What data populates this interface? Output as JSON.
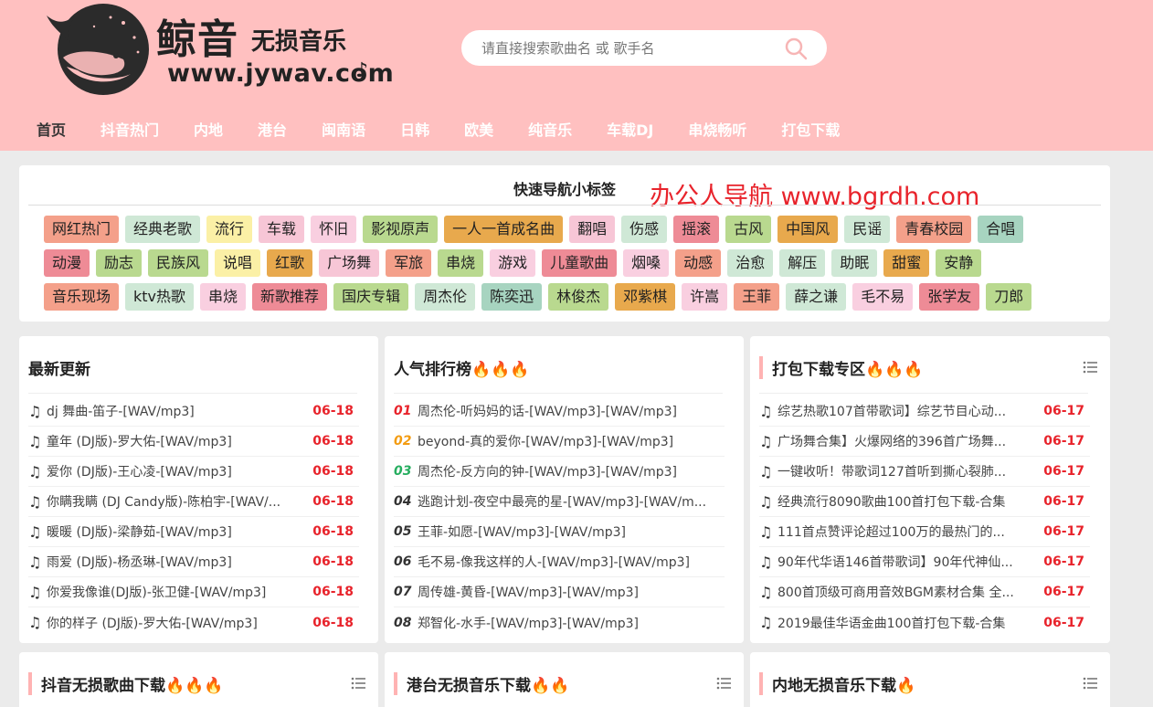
{
  "logo": {
    "title": "鲸音",
    "subtitle": "无损音乐",
    "url": "www.jywav.com",
    "note": "♪"
  },
  "search": {
    "placeholder": "请直接搜索歌曲名 或 歌手名",
    "icon": "search-icon"
  },
  "nav": [
    {
      "label": "首页",
      "active": true
    },
    {
      "label": "抖音热门"
    },
    {
      "label": "内地"
    },
    {
      "label": "港台"
    },
    {
      "label": "闽南语"
    },
    {
      "label": "日韩"
    },
    {
      "label": "欧美"
    },
    {
      "label": "纯音乐"
    },
    {
      "label": "车载DJ"
    },
    {
      "label": "串烧畅听"
    },
    {
      "label": "打包下载"
    }
  ],
  "tags": {
    "title": "快速导航小标签",
    "watermark": "办公人导航 www.bgrdh.com",
    "rows": [
      [
        {
          "label": "网红热门",
          "color": "#f4a08a"
        },
        {
          "label": "经典老歌",
          "color": "#cfe8d6"
        },
        {
          "label": "流行",
          "color": "#fbf0a6"
        },
        {
          "label": "车载",
          "color": "#f7c6d6"
        },
        {
          "label": "怀旧",
          "color": "#f9cfe0"
        },
        {
          "label": "影视原声",
          "color": "#b9d98f"
        },
        {
          "label": "一人一首成名曲",
          "color": "#e8a94d"
        },
        {
          "label": "翻唱",
          "color": "#f7c6d6"
        },
        {
          "label": "伤感",
          "color": "#cfe8d6"
        },
        {
          "label": "摇滚",
          "color": "#ee8b96"
        },
        {
          "label": "古风",
          "color": "#b9d98f"
        },
        {
          "label": "中国风",
          "color": "#e8a94d"
        },
        {
          "label": "民谣",
          "color": "#cfe8d6"
        },
        {
          "label": "青春校园",
          "color": "#f4a08a"
        },
        {
          "label": "合唱",
          "color": "#a7d4c0"
        }
      ],
      [
        {
          "label": "动漫",
          "color": "#ee8b96"
        },
        {
          "label": "励志",
          "color": "#b9d98f"
        },
        {
          "label": "民族风",
          "color": "#b9d98f"
        },
        {
          "label": "说唱",
          "color": "#fbf0a6"
        },
        {
          "label": "红歌",
          "color": "#e8a94d"
        },
        {
          "label": "广场舞",
          "color": "#f7c6d6"
        },
        {
          "label": "军旅",
          "color": "#f4a08a"
        },
        {
          "label": "串烧",
          "color": "#b9d98f"
        },
        {
          "label": "游戏",
          "color": "#f9cfe0"
        },
        {
          "label": "儿童歌曲",
          "color": "#ee8b96"
        },
        {
          "label": "烟嗓",
          "color": "#f9cfe0"
        },
        {
          "label": "动感",
          "color": "#f4a08a"
        },
        {
          "label": "治愈",
          "color": "#cfe8d6"
        },
        {
          "label": "解压",
          "color": "#cfe8d6"
        },
        {
          "label": "助眠",
          "color": "#cfe8d6"
        },
        {
          "label": "甜蜜",
          "color": "#e8a94d"
        },
        {
          "label": "安静",
          "color": "#b9d98f"
        }
      ],
      [
        {
          "label": "音乐现场",
          "color": "#f4a08a"
        },
        {
          "label": "ktv热歌",
          "color": "#cfe8d6"
        },
        {
          "label": "串烧",
          "color": "#f9cfe0"
        },
        {
          "label": "新歌推荐",
          "color": "#ee8b96"
        },
        {
          "label": "国庆专辑",
          "color": "#b9d98f"
        },
        {
          "label": "周杰伦",
          "color": "#cfe8d6"
        },
        {
          "label": "陈奕迅",
          "color": "#a7d4c0"
        },
        {
          "label": "林俊杰",
          "color": "#b9d98f"
        },
        {
          "label": "邓紫棋",
          "color": "#e8a94d"
        },
        {
          "label": "许嵩",
          "color": "#f9cfe0"
        },
        {
          "label": "王菲",
          "color": "#f4a08a"
        },
        {
          "label": "薛之谦",
          "color": "#cfe8d6"
        },
        {
          "label": "毛不易",
          "color": "#f9cfe0"
        },
        {
          "label": "张学友",
          "color": "#ee8b96"
        },
        {
          "label": "刀郎",
          "color": "#b9d98f"
        }
      ]
    ]
  },
  "latest": {
    "title": "最新更新",
    "items": [
      {
        "text": "dj 舞曲-笛子-[WAV/mp3]",
        "date": "06-18"
      },
      {
        "text": "童年 (DJ版)-罗大佑-[WAV/mp3]",
        "date": "06-18"
      },
      {
        "text": "爱你 (DJ版)-王心凌-[WAV/mp3]",
        "date": "06-18"
      },
      {
        "text": "你瞒我瞒 (DJ Candy版)-陈柏宇-[WAV/...",
        "date": "06-18"
      },
      {
        "text": "暖暖 (DJ版)-梁静茹-[WAV/mp3]",
        "date": "06-18"
      },
      {
        "text": "雨爱 (DJ版)-杨丞琳-[WAV/mp3]",
        "date": "06-18"
      },
      {
        "text": "你爱我像谁(DJ版)-张卫健-[WAV/mp3]",
        "date": "06-18"
      },
      {
        "text": "你的样子 (DJ版)-罗大佑-[WAV/mp3]",
        "date": "06-18"
      }
    ]
  },
  "popular": {
    "title": "人气排行榜",
    "fires": "🔥🔥🔥",
    "items": [
      {
        "num": "01",
        "color": "#e8232b",
        "text": "周杰伦-听妈妈的话-[WAV/mp3]-[WAV/mp3]"
      },
      {
        "num": "02",
        "color": "#f39c12",
        "text": "beyond-真的爱你-[WAV/mp3]-[WAV/mp3]"
      },
      {
        "num": "03",
        "color": "#27ae60",
        "text": "周杰伦-反方向的钟-[WAV/mp3]-[WAV/mp3]"
      },
      {
        "num": "04",
        "color": "#333333",
        "text": "逃跑计划-夜空中最亮的星-[WAV/mp3]-[WAV/m..."
      },
      {
        "num": "05",
        "color": "#333333",
        "text": "王菲-如愿-[WAV/mp3]-[WAV/mp3]"
      },
      {
        "num": "06",
        "color": "#333333",
        "text": "毛不易-像我这样的人-[WAV/mp3]-[WAV/mp3]"
      },
      {
        "num": "07",
        "color": "#333333",
        "text": "周传雄-黄昏-[WAV/mp3]-[WAV/mp3]"
      },
      {
        "num": "08",
        "color": "#333333",
        "text": "郑智化-水手-[WAV/mp3]-[WAV/mp3]"
      }
    ]
  },
  "packs": {
    "title": "打包下载专区",
    "fires": "🔥🔥🔥",
    "items": [
      {
        "text": "综艺热歌107首带歌词】综艺节目心动...",
        "date": "06-17"
      },
      {
        "text": "广场舞合集】火爆网络的396首广场舞...",
        "date": "06-17"
      },
      {
        "text": "一键收听！带歌词127首听到撕心裂肺...",
        "date": "06-17"
      },
      {
        "text": "经典流行8090歌曲100首打包下载-合集",
        "date": "06-17"
      },
      {
        "text": "111首点赞评论超过100万的最热门的...",
        "date": "06-17"
      },
      {
        "text": "90年代华语146首带歌词】90年代神仙...",
        "date": "06-17"
      },
      {
        "text": "800首顶级可商用音效BGM素材合集 全...",
        "date": "06-17"
      },
      {
        "text": "2019最佳华语金曲100首打包下载-合集",
        "date": "06-17"
      }
    ]
  },
  "bottom": [
    {
      "title": "抖音无损歌曲下载",
      "fires": "🔥🔥🔥"
    },
    {
      "title": "港台无损音乐下载",
      "fires": "🔥🔥"
    },
    {
      "title": "内地无损音乐下载",
      "fires": "🔥"
    }
  ]
}
